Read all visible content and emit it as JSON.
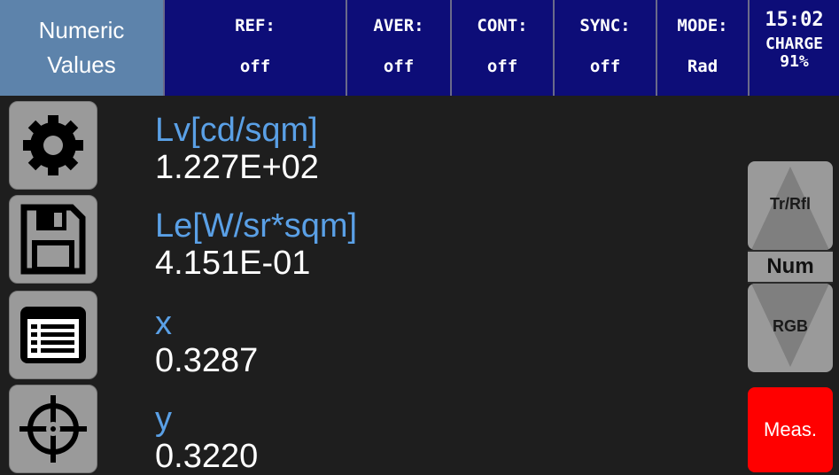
{
  "header": {
    "title_line1": "Numeric",
    "title_line2": "Values",
    "status": [
      {
        "label": "REF:",
        "value": "off"
      },
      {
        "label": "AVER:",
        "value": "off"
      },
      {
        "label": "CONT:",
        "value": "off"
      },
      {
        "label": "SYNC:",
        "value": "off"
      },
      {
        "label": "MODE:",
        "value": "Rad"
      }
    ],
    "clock": {
      "time": "15:02",
      "charge_label": "CHARGE",
      "charge_value": "91%"
    }
  },
  "sidebar": {
    "buttons": [
      {
        "icon": "gear-icon"
      },
      {
        "icon": "floppy-disk-icon"
      },
      {
        "icon": "list-icon"
      },
      {
        "icon": "crosshair-icon"
      }
    ]
  },
  "readings": [
    {
      "name": "Lv[cd/sqm]",
      "value": "1.227E+02"
    },
    {
      "name": "Le[W/sr*sqm]",
      "value": "4.151E-01"
    },
    {
      "name": "x",
      "value": "0.3287"
    },
    {
      "name": "y",
      "value": "0.3220"
    }
  ],
  "right_panel": {
    "up_label": "Tr/Rfl",
    "current_label": "Num",
    "down_label": "RGB",
    "measure_label": "Meas."
  },
  "colors": {
    "header_bg": "#0d0d78",
    "title_bg": "#5d83ab",
    "reading_name": "#5aa0e6",
    "reading_value": "#ffffff",
    "measure_button": "#ff0000",
    "button_gray": "#9a9a9a"
  }
}
